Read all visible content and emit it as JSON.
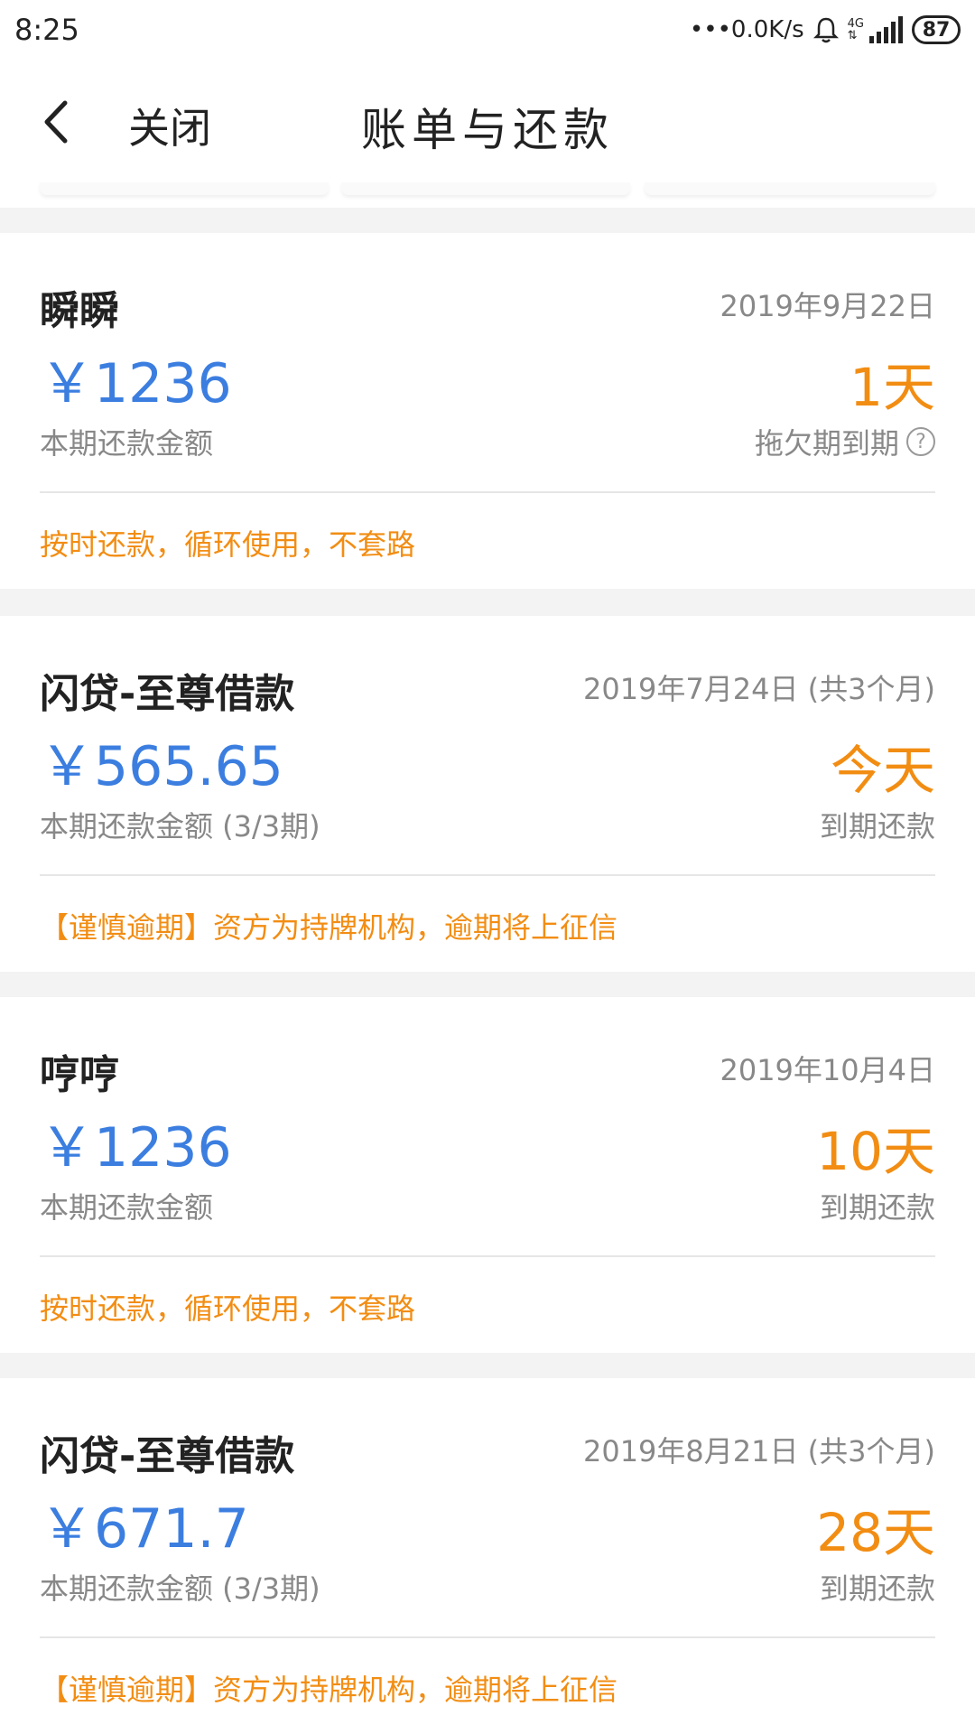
{
  "status_bar": {
    "time": "8:25",
    "network_speed": "•••0.0K/s",
    "network_type": "4G",
    "battery": "87"
  },
  "nav": {
    "close_label": "关闭",
    "title": "账单与还款"
  },
  "bills": [
    {
      "name": "瞬瞬",
      "date": "2019年9月22日",
      "amount": "￥1236",
      "days": "1天",
      "amount_label": "本期还款金额",
      "status": "拖欠期到期",
      "note": "按时还款，循环使用，不套路"
    },
    {
      "name": "闪贷-至尊借款",
      "date": "2019年7月24日 (共3个月)",
      "amount": "￥565.65",
      "days": "今天",
      "amount_label": "本期还款金额 (3/3期)",
      "status": "到期还款",
      "note": "【谨慎逾期】资方为持牌机构，逾期将上征信"
    },
    {
      "name": "哼哼",
      "date": "2019年10月4日",
      "amount": "￥1236",
      "days": "10天",
      "amount_label": "本期还款金额",
      "status": "到期还款",
      "note": "按时还款，循环使用，不套路"
    },
    {
      "name": "闪贷-至尊借款",
      "date": "2019年8月21日 (共3个月)",
      "amount": "￥671.7",
      "days": "28天",
      "amount_label": "本期还款金额 (3/3期)",
      "status": "到期还款",
      "note": "【谨慎逾期】资方为持牌机构，逾期将上征信"
    }
  ],
  "colors": {
    "amount": "#3b7ee0",
    "highlight": "#f28d13",
    "secondary_text": "#888888"
  }
}
